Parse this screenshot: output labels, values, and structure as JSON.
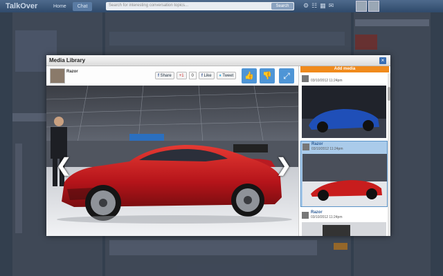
{
  "app": {
    "logo": "TalkOver",
    "nav": [
      "Home",
      "Chat"
    ],
    "search_placeholder": "Search for interesting conversation topics...",
    "search_button": "Search"
  },
  "modal": {
    "title": "Media Library",
    "close_symbol": "×",
    "author": "Razor",
    "share_label": "Share",
    "gplus_label": "+1",
    "gplus_count": "0",
    "like_label": "Like",
    "tweet_label": "Tweet",
    "add_media_label": "Add media",
    "prev_symbol": "❮",
    "next_symbol": "❯",
    "thumbnails": [
      {
        "name": "",
        "time": "03/10/2012 11:24pm",
        "selected": false
      },
      {
        "name": "Razor",
        "time": "03/10/2012 11:24pm",
        "selected": true
      },
      {
        "name": "Razor",
        "time": "03/10/2012 11:24pm",
        "selected": false
      }
    ]
  },
  "colors": {
    "accent_blue": "#4e95d6",
    "add_media_orange": "#f08a1c",
    "car_red": "#c81d1d",
    "car_blue": "#1f4fb8"
  },
  "icons": [
    "thumbs-up-icon",
    "thumbs-down-icon",
    "expand-icon",
    "close-icon",
    "prev-arrow-icon",
    "next-arrow-icon"
  ]
}
